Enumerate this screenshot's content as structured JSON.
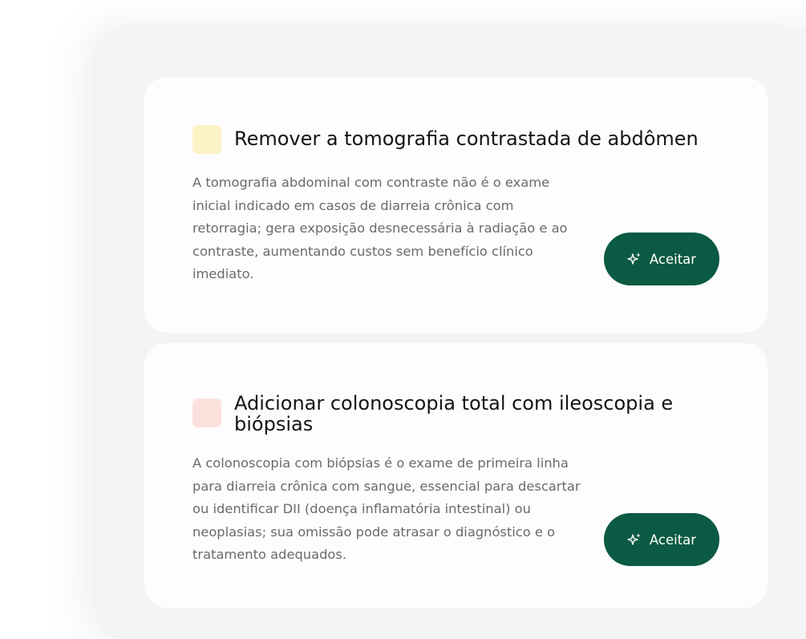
{
  "cards": [
    {
      "title": "Remover a tomografia contrastada de abdômen",
      "description": "A tomografia abdominal com contraste não é o exame inicial indicado em casos de diarreia crônica com retorragia; gera exposição desnecessária à radiação e ao contraste, aumentando custos sem benefício clínico imediato.",
      "button_label": "Aceitar",
      "button_icon": "sparkles-icon",
      "marker_color": "#fdf1c6"
    },
    {
      "title": "Adicionar colonoscopia total com ileoscopia e biópsias",
      "description": "A colonoscopia com biópsias é o exame de primeira linha para diarreia crônica com sangue, essencial para descartar ou identificar DII (doença inflamatória intestinal) ou neoplasias; sua omissão pode atrasar o diagnóstico e o tratamento adequados.",
      "button_label": "Aceitar",
      "button_icon": "sparkles-icon",
      "marker_color": "#fce0dc"
    }
  ],
  "colors": {
    "accent": "#0b5a43",
    "card_background": "#fdfdfd",
    "panel_background": "#f3f4f3"
  }
}
